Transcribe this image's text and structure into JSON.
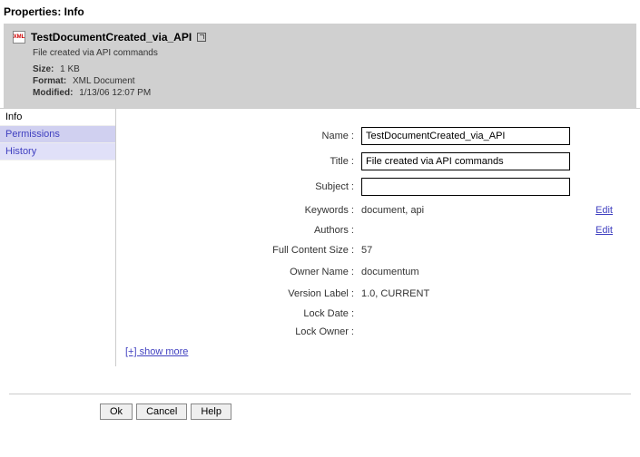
{
  "header": {
    "title": "Properties: Info"
  },
  "summary": {
    "icon": "XML",
    "title": "TestDocumentCreated_via_API",
    "desc": "File created via API commands",
    "size_label": "Size:",
    "size_value": "1 KB",
    "format_label": "Format:",
    "format_value": "XML Document",
    "modified_label": "Modified:",
    "modified_value": "1/13/06 12:07 PM"
  },
  "tabs": {
    "info": "Info",
    "permissions": "Permissions",
    "history": "History"
  },
  "form": {
    "name_label": "Name :",
    "name_value": "TestDocumentCreated_via_API",
    "title_label": "Title :",
    "title_value": "File created via API commands",
    "subject_label": "Subject :",
    "subject_value": "",
    "keywords_label": "Keywords :",
    "keywords_value": "document, api",
    "authors_label": "Authors :",
    "authors_value": "",
    "fullsize_label": "Full Content Size :",
    "fullsize_value": "57",
    "owner_label": "Owner Name :",
    "owner_value": "documentum",
    "version_label": "Version Label :",
    "version_value": "1.0, CURRENT",
    "lockdate_label": "Lock Date :",
    "lockdate_value": "",
    "lockowner_label": "Lock Owner :",
    "lockowner_value": "",
    "edit_link": "Edit",
    "show_more": "[+] show more"
  },
  "buttons": {
    "ok": "Ok",
    "cancel": "Cancel",
    "help": "Help"
  }
}
